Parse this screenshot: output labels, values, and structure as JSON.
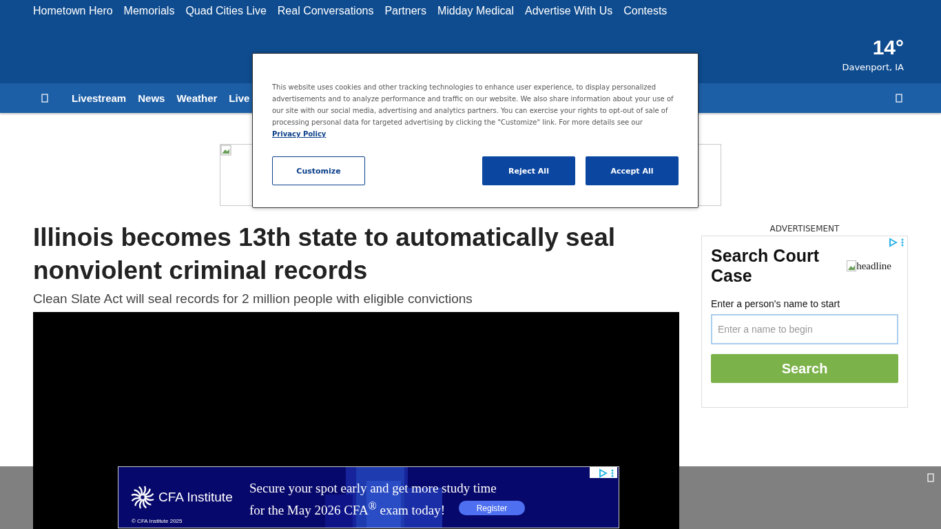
{
  "top_links": [
    "Hometown Hero",
    "Memorials",
    "Quad Cities Live",
    "Real Conversations",
    "Partners",
    "Midday Medical",
    "Advertise With Us",
    "Contests"
  ],
  "weather": {
    "temperature": "14°",
    "location": "Davenport, IA"
  },
  "nav": {
    "items": [
      "Livestream",
      "News",
      "Weather",
      "Live"
    ]
  },
  "article": {
    "headline": "Illinois becomes 13th state to automatically seal nonviolent criminal records",
    "subheadline": "Clean Slate Act will seal records for 2 million people with eligible convictions",
    "video": {
      "kind": "player"
    }
  },
  "side_ad": {
    "label": "ADVERTISEMENT",
    "title": "Search Court Case",
    "image_alt": "headline",
    "field_label": "Enter a person's name to start",
    "placeholder": "Enter a name to begin",
    "button": "Search"
  },
  "bottom_ad": {
    "brand": "CFA Institute",
    "headline": "Secure your spot early and get more study time",
    "headline_2": "for the May 2026 CFA$^{®}$ exam today!",
    "button": "Register",
    "copyright": "© CFA Institute 2025"
  },
  "cookie_dialog": {
    "text": "This website uses cookies and other tracking technologies to enhance user experience, to display personalized advertisements and to analyze performance and traffic on our website. We also share information about your use of our site with our social media, advertising and analytics partners. You can exercise your rights to opt-out of sale of processing personal data for targeted advertising by clicking the \"Customize\" link. For more details see our",
    "link": "Privacy Policy",
    "buttons": [
      {
        "label": "Customize",
        "kind": "outline"
      },
      {
        "label": "Reject All",
        "kind": "solid"
      },
      {
        "label": "Accept All",
        "kind": "solid"
      }
    ]
  }
}
